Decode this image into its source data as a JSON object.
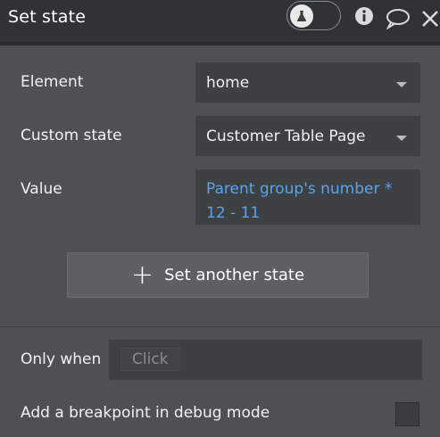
{
  "header": {
    "title": "Set state",
    "icons": [
      "debug-toggle-icon",
      "info-icon",
      "comment-icon",
      "close-icon"
    ]
  },
  "fields": {
    "element": {
      "label": "Element",
      "value": "home"
    },
    "custom_state": {
      "label": "Custom state",
      "value": "Customer Table Page"
    },
    "value": {
      "label": "Value",
      "line1": "Parent group's number *",
      "line2": "12 - 11"
    }
  },
  "actions": {
    "set_another_state": "Set another state"
  },
  "only_when": {
    "label": "Only when",
    "placeholder": "Click"
  },
  "breakpoint": {
    "label": "Add a breakpoint in debug mode",
    "checked": false
  },
  "colors": {
    "dynamic_text": "#5aa2ef",
    "panel_bg": "#4d5154",
    "header_bg": "#2f3337"
  }
}
